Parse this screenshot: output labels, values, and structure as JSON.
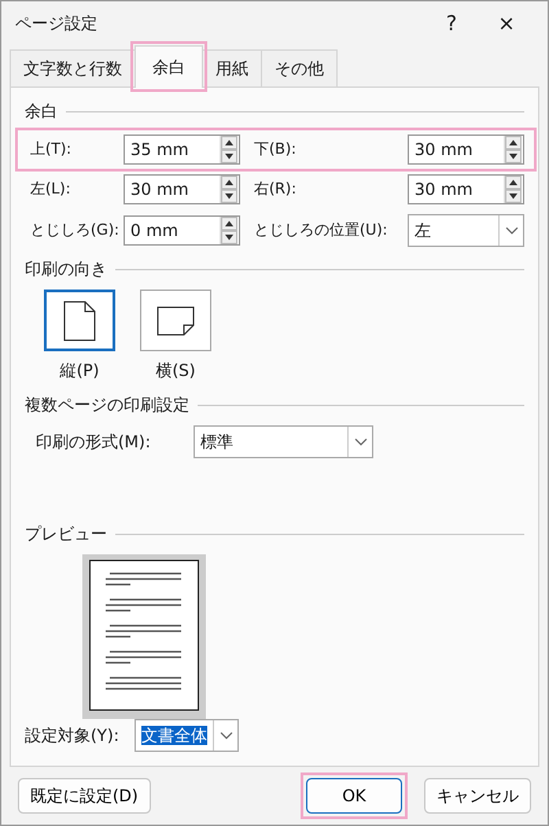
{
  "window": {
    "title": "ページ設定",
    "help": "?",
    "close": "×"
  },
  "tabs": [
    {
      "label": "文字数と行数",
      "selected": false,
      "highlighted": false
    },
    {
      "label": "余白",
      "selected": true,
      "highlighted": true
    },
    {
      "label": "用紙",
      "selected": false,
      "highlighted": false
    },
    {
      "label": "その他",
      "selected": false,
      "highlighted": false
    }
  ],
  "margins": {
    "heading": "余白",
    "rows": [
      {
        "highlighted": true,
        "fields": [
          {
            "kind": "spin",
            "label": "上(T):",
            "value": "35 mm"
          },
          {
            "kind": "spin",
            "label": "下(B):",
            "value": "30 mm"
          }
        ]
      },
      {
        "highlighted": false,
        "fields": [
          {
            "kind": "spin",
            "label": "左(L):",
            "value": "30 mm"
          },
          {
            "kind": "spin",
            "label": "右(R):",
            "value": "30 mm"
          }
        ]
      },
      {
        "highlighted": false,
        "fields": [
          {
            "kind": "spin",
            "label": "とじしろ(G):",
            "value": "0 mm"
          },
          {
            "kind": "select",
            "label": "とじしろの位置(U):",
            "value": "左"
          }
        ]
      }
    ]
  },
  "orientation": {
    "heading": "印刷の向き",
    "options": [
      {
        "kind": "portrait",
        "label": "縦(P)",
        "selected": true
      },
      {
        "kind": "landscape",
        "label": "横(S)",
        "selected": false
      }
    ]
  },
  "multiple_pages": {
    "heading": "複数ページの印刷設定",
    "label": "印刷の形式(M):",
    "value": "標準"
  },
  "preview": {
    "heading": "プレビュー"
  },
  "apply_to": {
    "label": "設定対象(Y):",
    "value": "文書全体"
  },
  "buttons": [
    {
      "label": "既定に設定(D)",
      "kind": "left",
      "highlighted": false
    },
    {
      "label": "OK",
      "kind": "primary",
      "highlighted": true
    },
    {
      "label": "キャンセル",
      "kind": "normal",
      "highlighted": false
    }
  ]
}
